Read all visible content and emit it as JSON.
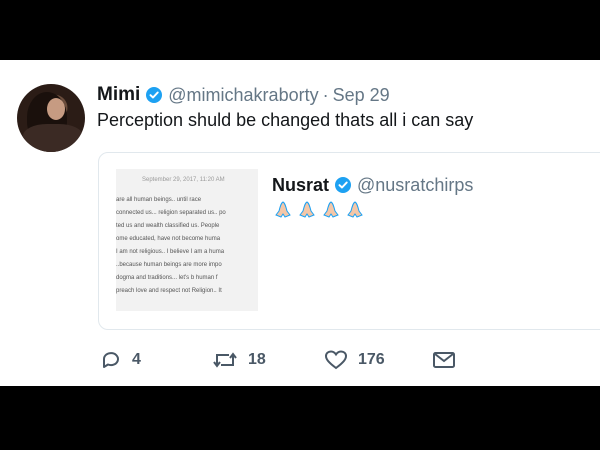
{
  "tweet": {
    "author_name": "Mimi",
    "author_handle": "@mimichakraborty",
    "separator": "·",
    "date": "Sep 29",
    "text": "Perception shuld be changed thats all i can say",
    "avatar_icon": "profile-photo"
  },
  "quoted": {
    "author_name": "Nusrat",
    "author_handle": "@nusratchirps",
    "emoji": "folded-hands x4",
    "image_text": {
      "timestamp": "September 29, 2017, 11:20 AM",
      "lines": [
        "are all human beings.. until race",
        "connected us... religion separated us.. po",
        "ted us and wealth classified us. People",
        "ome educated, have not become huma",
        "I am not religious.. I believe I am a huma",
        "..because human beings are more impo",
        "dogma and traditions... let's b human f",
        "preach love and respect not Religion.. It"
      ]
    }
  },
  "actions": {
    "reply_count": "4",
    "retweet_count": "18",
    "like_count": "176"
  },
  "colors": {
    "verified": "#1da1f2",
    "text": "#14171a",
    "muted": "#657786",
    "border": "#e1e8ed"
  }
}
